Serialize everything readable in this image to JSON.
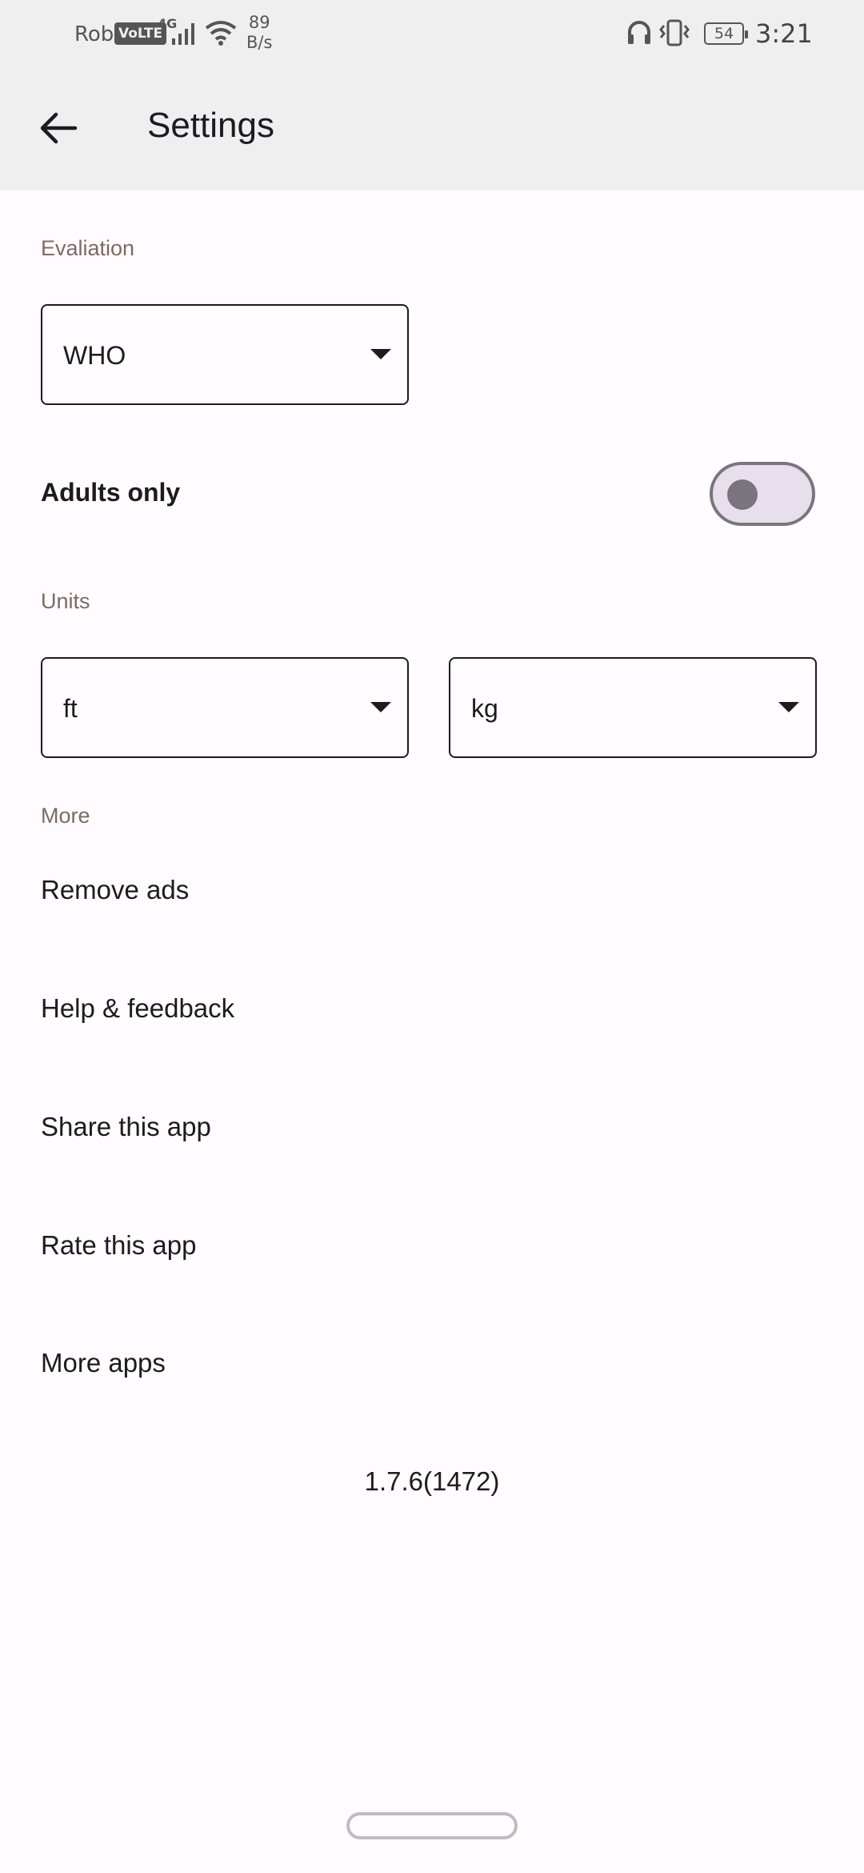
{
  "status_bar": {
    "carrier": "Robi",
    "volte": "VoLTE",
    "network": "4G",
    "speed_value": "89",
    "speed_unit": "B/s",
    "battery": "54",
    "time": "3:21",
    "icons": [
      "signal-icon",
      "wifi-icon",
      "headphones-icon",
      "vibrate-icon",
      "battery-icon"
    ]
  },
  "app_bar": {
    "back_icon": "arrow-back-icon",
    "title": "Settings"
  },
  "evaluation": {
    "section_label": "Evaliation",
    "dropdown_value": "WHO"
  },
  "adults_only": {
    "label": "Adults only",
    "enabled": false
  },
  "units": {
    "section_label": "Units",
    "length_value": "ft",
    "weight_value": "kg"
  },
  "more": {
    "section_label": "More",
    "items": [
      {
        "label": "Remove ads"
      },
      {
        "label": "Help & feedback"
      },
      {
        "label": "Share this app"
      },
      {
        "label": "Rate this app"
      },
      {
        "label": "More apps"
      }
    ]
  },
  "version": "1.7.6(1472)",
  "colors": {
    "app_bar_bg": "#efefef",
    "page_bg": "#fffbfe",
    "section_label": "#7d6a62",
    "toggle_outline": "#79747e"
  }
}
